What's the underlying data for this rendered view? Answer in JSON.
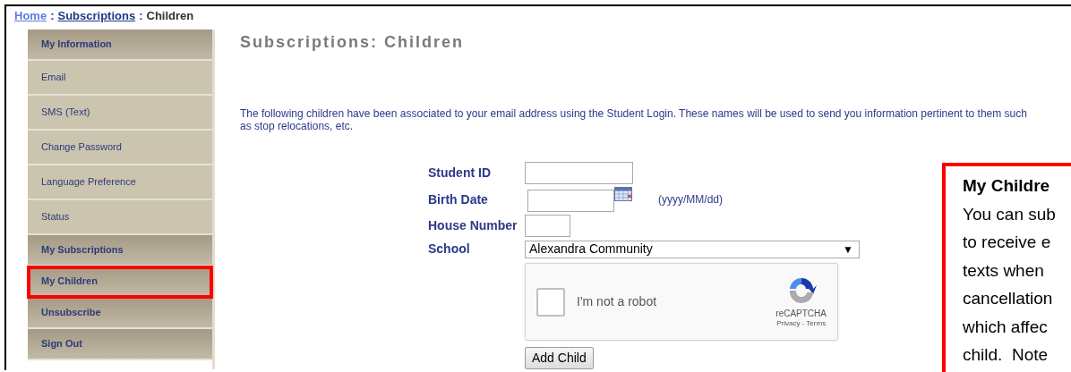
{
  "breadcrumb": [
    {
      "text": "Home",
      "kind": "link",
      "visited": false
    },
    {
      "text": ":",
      "kind": "separator"
    },
    {
      "text": "Subscriptions",
      "kind": "link",
      "visited": true
    },
    {
      "text": ":",
      "kind": "separator"
    },
    {
      "text": "Children",
      "kind": "current"
    }
  ],
  "sidebar": {
    "items": [
      {
        "label": "My Information",
        "kind": "header",
        "highlighted": false
      },
      {
        "label": "Email",
        "kind": "sub",
        "highlighted": false
      },
      {
        "label": "SMS (Text)",
        "kind": "sub",
        "highlighted": false
      },
      {
        "label": "Change Password",
        "kind": "sub",
        "highlighted": false
      },
      {
        "label": "Language Preference",
        "kind": "sub",
        "highlighted": false
      },
      {
        "label": "Status",
        "kind": "sub",
        "highlighted": false
      },
      {
        "label": "My Subscriptions",
        "kind": "header",
        "highlighted": false
      },
      {
        "label": "My Children",
        "kind": "header",
        "highlighted": true
      },
      {
        "label": "Unsubscribe",
        "kind": "header",
        "highlighted": false
      },
      {
        "label": "Sign Out",
        "kind": "header",
        "highlighted": false
      }
    ]
  },
  "heading": "Subscriptions: Children",
  "intro": "The following children have been associated to your email address using the Student Login. These names will be used to send you information pertinent to them such as stop relocations, etc.",
  "form": {
    "fields": [
      {
        "label": "Student ID",
        "kind": "text"
      },
      {
        "label": "Birth Date",
        "kind": "date",
        "hint": "(yyyy/MM/dd)"
      },
      {
        "label": "House Number",
        "kind": "short"
      },
      {
        "label": "School",
        "kind": "select",
        "value": "Alexandra Community",
        "arrow": "▼"
      }
    ],
    "captcha": {
      "label": "I'm not a robot",
      "checked": false,
      "brand": "reCAPTCHA",
      "links": "Privacy - Terms"
    },
    "button": "Add Child"
  },
  "callout": {
    "title": "My Childre",
    "lines": [
      "You can sub",
      "to receive e",
      "texts when",
      "cancellation",
      "which affec",
      "child.  Note"
    ]
  }
}
